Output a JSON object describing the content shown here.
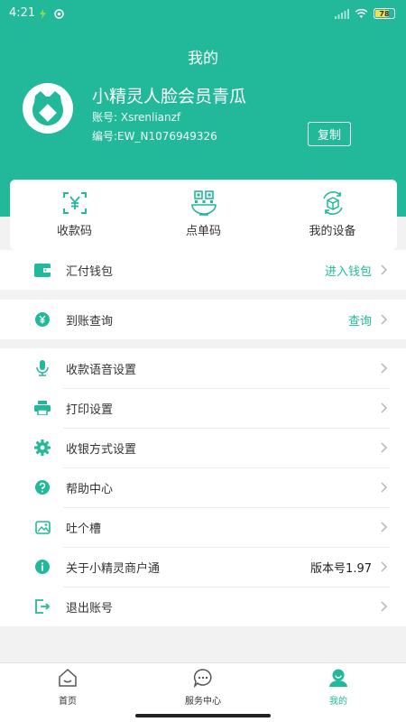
{
  "status": {
    "time": "4:21",
    "battery": "78"
  },
  "header": {
    "title": "我的",
    "user_name": "小精灵人脸会员青瓜",
    "account": "账号: Xsrenlianzf",
    "serial": "编号:EW_N1076949326",
    "copy_label": "复制"
  },
  "quick": {
    "items": [
      {
        "label": "收款码",
        "icon": "qr-yuan-scan-icon"
      },
      {
        "label": "点单码",
        "icon": "qr-bowl-icon"
      },
      {
        "label": "我的设备",
        "icon": "device-box-icon"
      }
    ]
  },
  "wallet": {
    "label": "汇付钱包",
    "value": "进入钱包"
  },
  "arrival": {
    "label": "到账查询",
    "value": "查询"
  },
  "menu": {
    "items": [
      {
        "label": "收款语音设置",
        "value": ""
      },
      {
        "label": "打印设置",
        "value": ""
      },
      {
        "label": "收银方式设置",
        "value": ""
      },
      {
        "label": "帮助中心",
        "value": ""
      },
      {
        "label": "吐个槽",
        "value": ""
      },
      {
        "label": "关于小精灵商户通",
        "value": "版本号1.97"
      },
      {
        "label": "退出账号",
        "value": ""
      }
    ]
  },
  "tabs": [
    {
      "label": "首页"
    },
    {
      "label": "服务中心"
    },
    {
      "label": "我的"
    }
  ],
  "colors": {
    "accent": "#22b99a",
    "background": "#f2f2f2"
  }
}
